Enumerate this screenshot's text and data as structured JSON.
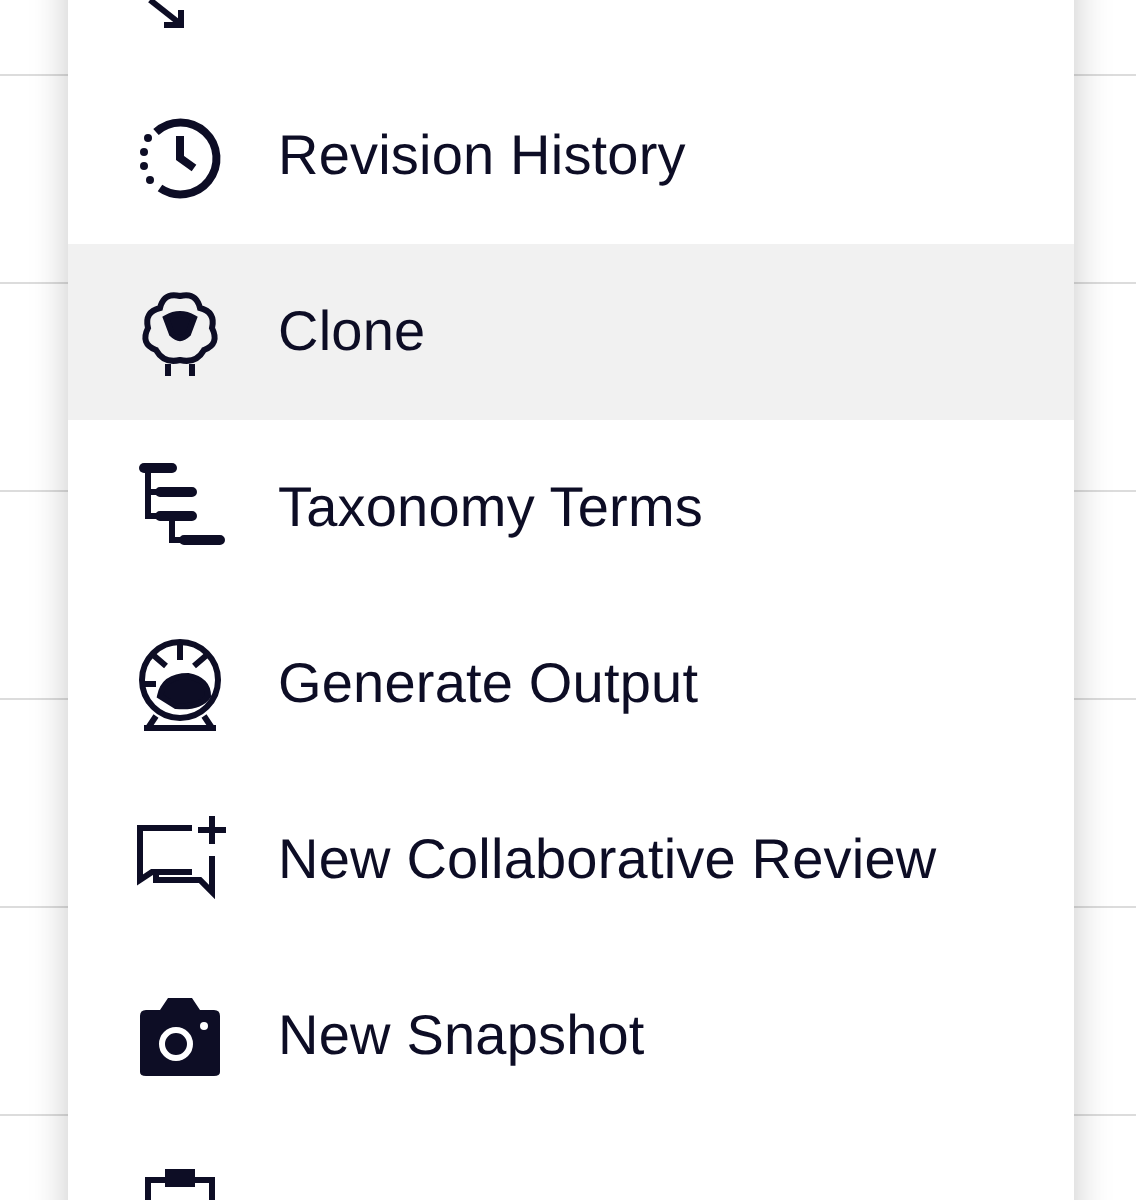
{
  "menu": {
    "items": [
      {
        "kind": "cut",
        "selected": false
      },
      {
        "kind": "full",
        "label": "Revision History",
        "selected": false
      },
      {
        "kind": "full",
        "label": "Clone",
        "selected": true
      },
      {
        "kind": "full",
        "label": "Taxonomy Terms",
        "selected": false
      },
      {
        "kind": "full",
        "label": "Generate Output",
        "selected": false
      },
      {
        "kind": "full",
        "label": "New Collaborative Review",
        "selected": false
      },
      {
        "kind": "full",
        "label": "New Snapshot",
        "selected": false
      },
      {
        "kind": "cut",
        "selected": false
      }
    ]
  }
}
